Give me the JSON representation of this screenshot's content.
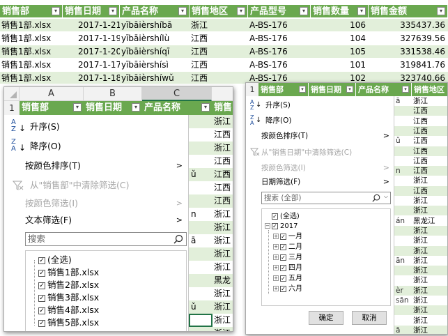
{
  "top_table": {
    "headers": [
      "销售部",
      "销售日期",
      "产品名称",
      "销售地区",
      "产品型号",
      "销售数量",
      "销售金额"
    ],
    "rows": [
      [
        "销售1部.xlsx",
        "2017-1-21",
        "yībāièrshíbā",
        "浙江",
        "A-BS-176",
        "106",
        "335437.36"
      ],
      [
        "销售1部.xlsx",
        "2017-1-19",
        "yībāièrshílù",
        "江西",
        "A-BS-176",
        "104",
        "327639.56"
      ],
      [
        "销售1部.xlsx",
        "2017-1-20",
        "yībāièrshíqī",
        "江西",
        "A-BS-176",
        "105",
        "331538.46"
      ],
      [
        "销售1部.xlsx",
        "2017-1-17",
        "yībāièrshísì",
        "江西",
        "A-BS-176",
        "101",
        "319841.76"
      ],
      [
        "销售1部.xlsx",
        "2017-1-18",
        "yībāièrshíwǔ",
        "江西",
        "A-BS-176",
        "102",
        "323740.66"
      ]
    ]
  },
  "left_window": {
    "col_letters": [
      "A",
      "B",
      "C"
    ],
    "row_number": "1",
    "header_cells": [
      "销售部",
      "销售日期",
      "产品名称",
      "销售"
    ],
    "menu": {
      "sort_asc": "升序(S)",
      "sort_desc": "降序(O)",
      "sort_by_color": "按颜色排序(T)",
      "clear_filter": "从\"销售部\"中清除筛选(C)",
      "filter_by_color": "按颜色筛选(I)",
      "text_filter": "文本筛选(F)",
      "search_placeholder": "搜索",
      "items": [
        "(全选)",
        "销售1部.xlsx",
        "销售2部.xlsx",
        "销售3部.xlsx",
        "销售4部.xlsx",
        "销售5部.xlsx"
      ]
    },
    "bg_cells": [
      {
        "pre": "",
        "val": "浙江"
      },
      {
        "pre": "",
        "val": "江西"
      },
      {
        "pre": "",
        "val": "浙江"
      },
      {
        "pre": "",
        "val": "江西"
      },
      {
        "pre": "ǔ",
        "val": "江西"
      },
      {
        "pre": "",
        "val": "江西"
      },
      {
        "pre": "",
        "val": "江西"
      },
      {
        "pre": "n",
        "val": "浙江"
      },
      {
        "pre": "",
        "val": "浙江"
      },
      {
        "pre": "ā",
        "val": "浙江"
      },
      {
        "pre": "",
        "val": "浙江"
      },
      {
        "pre": "",
        "val": "浙江"
      },
      {
        "pre": "",
        "val": "黑龙"
      },
      {
        "pre": "",
        "val": "浙江"
      },
      {
        "pre": "ǔ",
        "val": "浙江"
      },
      {
        "pre": "",
        "val": "浙江"
      },
      {
        "pre": "",
        "val": "浙江"
      }
    ]
  },
  "right_window": {
    "row_number": "1",
    "header_cells": [
      "销售部",
      "销售日期",
      "产品名称",
      "销售地区"
    ],
    "menu": {
      "sort_asc": "升序(S)",
      "sort_desc": "降序(O)",
      "sort_by_color": "按颜色排序(T)",
      "clear_filter": "从\"销售日期\"中清除筛选(C)",
      "filter_by_color": "按颜色筛选(I)",
      "date_filter": "日期筛选(F)",
      "search_placeholder": "搜索 (全部)",
      "select_all": "(全选)",
      "year": "2017",
      "months": [
        "一月",
        "二月",
        "三月",
        "四月",
        "五月",
        "六月"
      ],
      "ok": "确定",
      "cancel": "取消"
    },
    "bg_cells": [
      {
        "pre": "ā",
        "val": "浙江"
      },
      {
        "pre": "",
        "val": "江西"
      },
      {
        "pre": "",
        "val": "江西"
      },
      {
        "pre": "",
        "val": "江西"
      },
      {
        "pre": "ǔ",
        "val": "江西"
      },
      {
        "pre": "",
        "val": "江西"
      },
      {
        "pre": "",
        "val": "江西"
      },
      {
        "pre": "n",
        "val": "江西"
      },
      {
        "pre": "",
        "val": "浙江"
      },
      {
        "pre": "",
        "val": "江西"
      },
      {
        "pre": "",
        "val": "浙江"
      },
      {
        "pre": "",
        "val": "浙江"
      },
      {
        "pre": "án",
        "val": "黑龙江"
      },
      {
        "pre": "",
        "val": "浙江"
      },
      {
        "pre": "",
        "val": "浙江"
      },
      {
        "pre": "",
        "val": "浙江"
      },
      {
        "pre": "ān",
        "val": "浙江"
      },
      {
        "pre": "",
        "val": "浙江"
      },
      {
        "pre": "",
        "val": "浙江"
      },
      {
        "pre": "èr",
        "val": "浙江"
      },
      {
        "pre": "sān",
        "val": "浙江"
      },
      {
        "pre": "",
        "val": "浙江"
      },
      {
        "pre": "",
        "val": "浙江"
      },
      {
        "pre": "ā",
        "val": "浙江"
      }
    ]
  },
  "colors": {
    "header_green": "#6aa84f",
    "row_band": "#e2efda",
    "excel_green": "#217346"
  }
}
